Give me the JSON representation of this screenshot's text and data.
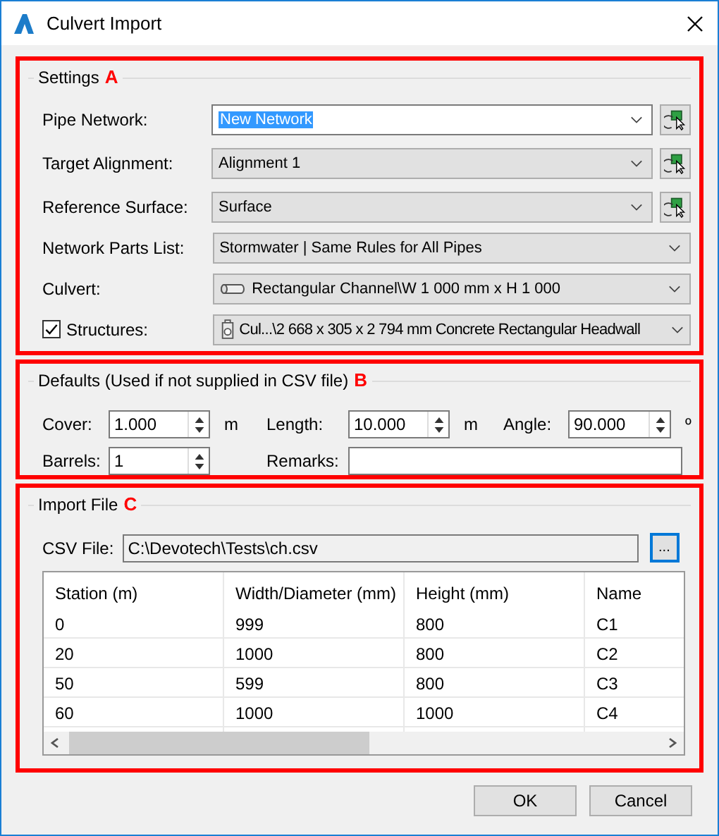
{
  "window": {
    "title": "Culvert Import"
  },
  "settings": {
    "title": "Settings",
    "marker": "A",
    "fields": [
      {
        "kind": "editable",
        "label": "Pipe Network:",
        "value": "New Network",
        "pick_button": true
      },
      {
        "kind": "dropdown",
        "label": "Target Alignment:",
        "value": "Alignment 1",
        "pick_button": true
      },
      {
        "kind": "dropdown",
        "label": "Reference Surface:",
        "value": "Surface",
        "pick_button": true
      },
      {
        "kind": "dropdown",
        "label": "Network Parts List:",
        "value": "Stormwater | Same Rules for All Pipes",
        "pick_button": false
      },
      {
        "kind": "culvert",
        "label": "Culvert:",
        "value": "Rectangular Channel\\W 1 000 mm x H 1 000",
        "pick_button": false
      },
      {
        "kind": "structures",
        "label": "Structures:",
        "value": "Cul...\\2 668 x 305 x 2 794 mm Concrete Rectangular Headwall",
        "pick_button": false,
        "checked": true
      }
    ]
  },
  "defaults": {
    "title": "Defaults (Used if not supplied in CSV file)",
    "marker": "B",
    "spinners": [
      {
        "label": "Cover:",
        "value": "1.000",
        "unit": "m"
      },
      {
        "label": "Length:",
        "value": "10.000",
        "unit": "m"
      },
      {
        "label": "Angle:",
        "value": "90.000",
        "unit": "º"
      },
      {
        "label": "Barrels:",
        "value": "1"
      }
    ],
    "remarks": {
      "label": "Remarks:"
    }
  },
  "import_file": {
    "title": "Import File",
    "marker": "C",
    "csv_label": "CSV File:",
    "csv_path": "C:\\Devotech\\Tests\\ch.csv",
    "browse": "...",
    "table": {
      "columns": [
        "Station (m)",
        "Width/Diameter (mm)",
        "Height (mm)",
        "Name"
      ],
      "rows": [
        [
          "0",
          "999",
          "800",
          "C1"
        ],
        [
          "20",
          "1000",
          "800",
          "C2"
        ],
        [
          "50",
          "599",
          "800",
          "C3"
        ],
        [
          "60",
          "1000",
          "1000",
          "C4"
        ]
      ]
    }
  },
  "buttons": [
    "OK",
    "Cancel"
  ]
}
